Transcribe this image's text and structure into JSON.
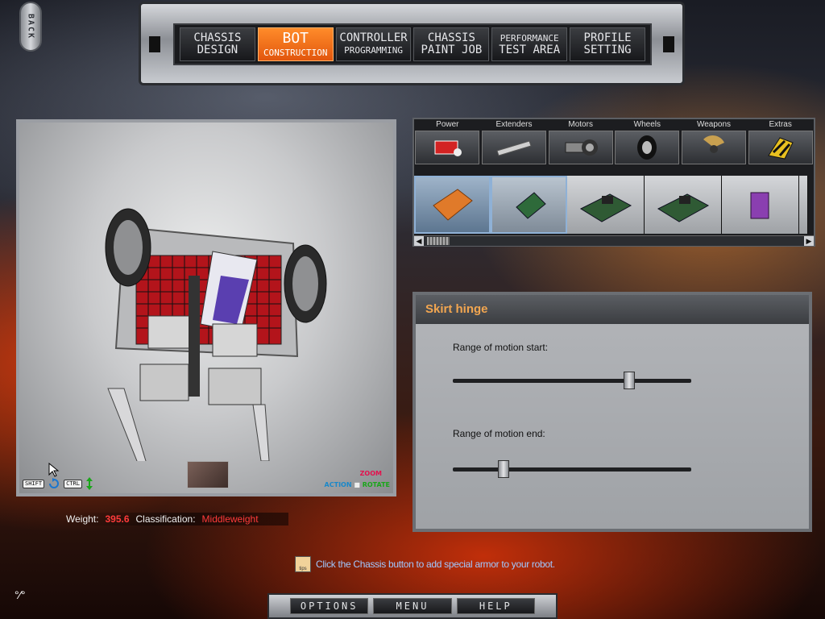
{
  "back_button": {
    "label": "BACK"
  },
  "top_nav": {
    "tabs": [
      {
        "line1": "CHASSIS",
        "line2": "DESIGN",
        "active": false
      },
      {
        "line1": "BOT",
        "line2": "CONSTRUCTION",
        "active": true
      },
      {
        "line1": "CONTROLLER",
        "line2": "PROGRAMMING",
        "active": false
      },
      {
        "line1": "CHASSIS",
        "line2": "PAINT JOB",
        "active": false
      },
      {
        "line1": "PERFORMANCE",
        "line2": "TEST AREA",
        "active": false
      },
      {
        "line1": "PROFILE",
        "line2": "SETTING",
        "active": false
      }
    ]
  },
  "viewport": {
    "shift_key": "SHIFT",
    "ctrl_key": "CTRL",
    "action_label": "ACTION",
    "zoom_label": "ZOOM",
    "rotate_label": "ROTATE"
  },
  "stats": {
    "weight_label": "Weight:",
    "weight_value": "395.6",
    "classification_label": "Classification:",
    "classification_value": "Middleweight"
  },
  "parts": {
    "categories": [
      "Power",
      "Extenders",
      "Motors",
      "Wheels",
      "Weapons",
      "Extras"
    ],
    "selected_category": "Power"
  },
  "properties": {
    "title": "Skirt hinge",
    "start_label": "Range of motion start:",
    "start_value": 0.75,
    "end_label": "Range of motion end:",
    "end_value": 0.2
  },
  "tip": {
    "icon_text": "tips",
    "text": "Click the Chassis button to add special armor to your robot."
  },
  "bottom_menu": {
    "options": "OPTIONS",
    "menu": "MENU",
    "help": "HELP"
  },
  "colors": {
    "accent": "#f0802a",
    "danger": "#ff3b3b",
    "tip": "#a0c8ff",
    "panel_title": "#f2a650"
  }
}
